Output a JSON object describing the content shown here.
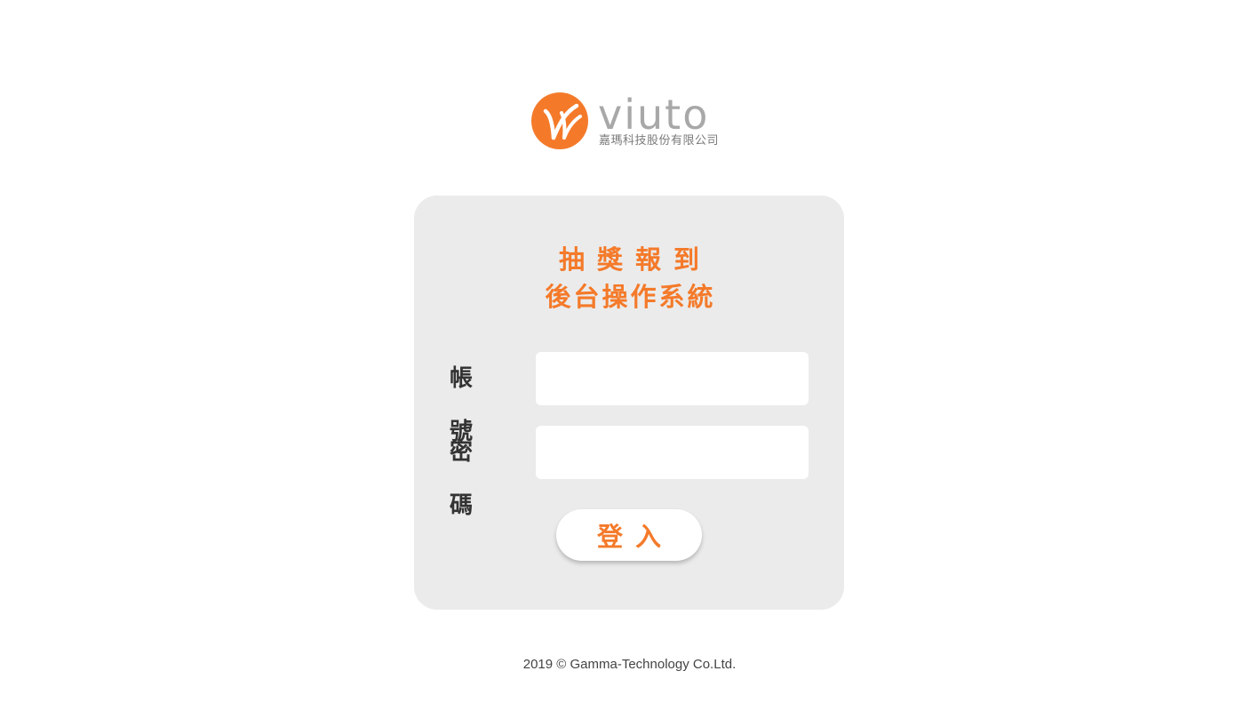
{
  "brand": {
    "wordmark": "viuto",
    "company": "嘉瑪科技股份有限公司",
    "accent_color": "#f47a2a"
  },
  "login_card": {
    "title_line1": "抽獎報到",
    "title_line2": "後台操作系統",
    "account_label": "帳號",
    "account_value": "",
    "password_label": "密碼",
    "password_value": "",
    "login_button": "登入"
  },
  "footer": {
    "copyright": "2019 ©  Gamma-Technology Co.Ltd."
  }
}
